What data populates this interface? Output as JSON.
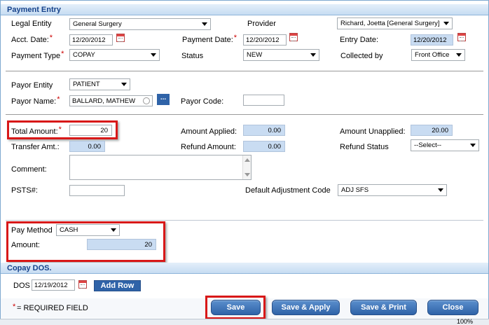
{
  "sections": {
    "payment_entry": "Payment Entry",
    "copay_dos": "Copay DOS."
  },
  "fields": {
    "legal_entity": {
      "label": "Legal Entity",
      "value": "General Surgery"
    },
    "provider": {
      "label": "Provider",
      "value": "Richard, Joetta [General Surgery]"
    },
    "acct_date": {
      "label": "Acct. Date:",
      "value": "12/20/2012"
    },
    "payment_date": {
      "label": "Payment Date:",
      "value": "12/20/2012"
    },
    "entry_date": {
      "label": "Entry Date:",
      "value": "12/20/2012"
    },
    "payment_type": {
      "label": "Payment Type",
      "value": "COPAY"
    },
    "status": {
      "label": "Status",
      "value": "NEW"
    },
    "collected_by": {
      "label": "Collected by",
      "value": "Front Office"
    },
    "payor_entity": {
      "label": "Payor Entity",
      "value": "PATIENT"
    },
    "payor_name": {
      "label": "Payor Name:",
      "value": "BALLARD, MATHEW",
      "lookup": "..."
    },
    "payor_code": {
      "label": "Payor Code:",
      "value": ""
    },
    "total_amount": {
      "label": "Total Amount:",
      "value": "20"
    },
    "amount_applied": {
      "label": "Amount Applied:",
      "value": "0.00"
    },
    "amount_unapplied": {
      "label": "Amount Unapplied:",
      "value": "20.00"
    },
    "transfer_amt": {
      "label": "Transfer Amt.:",
      "value": "0.00"
    },
    "refund_amount": {
      "label": "Refund Amount:",
      "value": "0.00"
    },
    "refund_status": {
      "label": "Refund Status",
      "value": "--Select--"
    },
    "comment": {
      "label": "Comment:",
      "value": ""
    },
    "psts": {
      "label": "PSTS#:",
      "value": ""
    },
    "default_adjustment_code": {
      "label": "Default Adjustment Code",
      "value": "ADJ SFS"
    },
    "pay_method": {
      "label": "Pay Method",
      "value": "CASH"
    },
    "amount": {
      "label": "Amount:",
      "value": "20"
    },
    "dos": {
      "label": "DOS",
      "value": "12/19/2012"
    }
  },
  "required_marker": "*",
  "required_note": "= REQUIRED FIELD",
  "buttons": {
    "add_row": "Add Row",
    "save": "Save",
    "save_apply": "Save & Apply",
    "save_print": "Save & Print",
    "close": "Close"
  },
  "status_bar": {
    "zoom": "100%"
  },
  "colors": {
    "header_text": "#15428b",
    "highlight_box": "#d81818",
    "button": "#2f63a8",
    "readonly_field": "#c9dcf2"
  }
}
